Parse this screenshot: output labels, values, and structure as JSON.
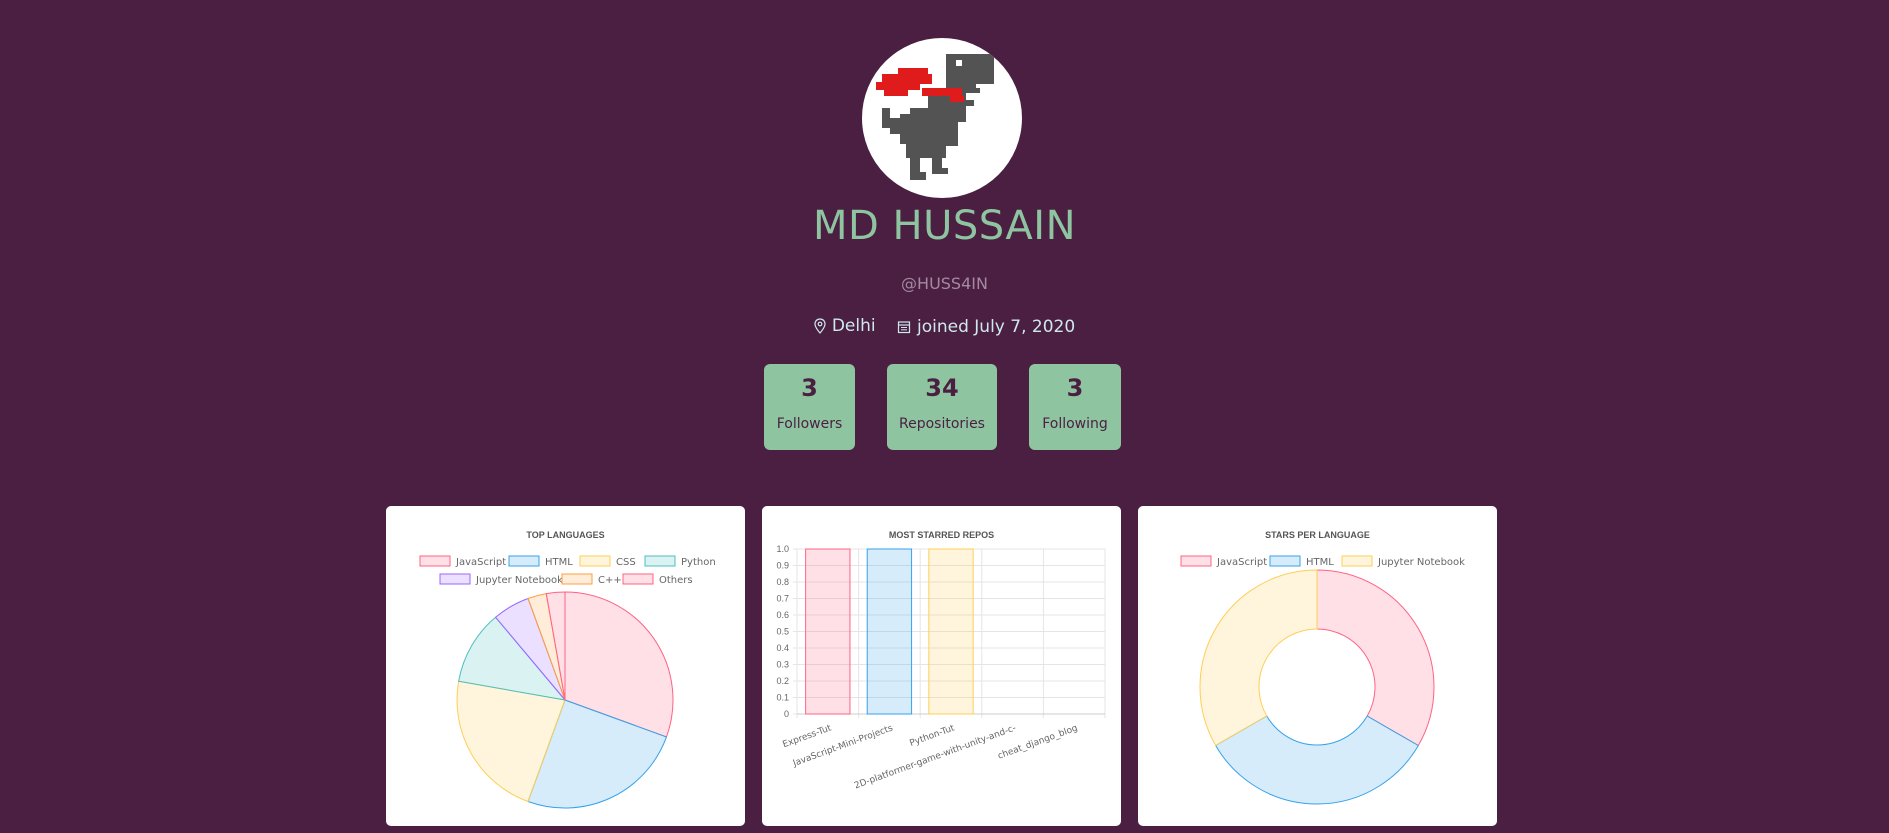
{
  "profile": {
    "name": "MD HUSSAIN",
    "handle": "@HUSS4IN",
    "location": "Delhi",
    "joined": "joined July 7, 2020"
  },
  "stats": [
    {
      "value": "3",
      "label": "Followers"
    },
    {
      "value": "34",
      "label": "Repositories"
    },
    {
      "value": "3",
      "label": "Following"
    }
  ],
  "colors": {
    "background": "#4a1f42",
    "accent": "#8ec5a0",
    "series": [
      "#ff6384",
      "#36a2eb",
      "#ffce56",
      "#4bc0c0",
      "#9966ff",
      "#ff9f40",
      "#ff6384"
    ]
  },
  "icons": {
    "location": "map-pin-icon",
    "calendar": "calendar-icon"
  },
  "chart_data": [
    {
      "type": "pie",
      "title": "TOP LANGUAGES",
      "labels": [
        "JavaScript",
        "HTML",
        "CSS",
        "Python",
        "Jupyter Notebook",
        "C++",
        "Others"
      ],
      "values": [
        11,
        9,
        8,
        4,
        2,
        1,
        1
      ],
      "legend": "top"
    },
    {
      "type": "bar",
      "title": "MOST STARRED REPOS",
      "categories": [
        "Express-Tut",
        "JavaScript-Mini-Projects",
        "Python-Tut",
        "2D-platformer-game-with-unity-and-c-",
        "cheat_django_blog"
      ],
      "values": [
        1,
        1,
        1,
        0,
        0
      ],
      "ylim": [
        0,
        1
      ],
      "yticks": [
        "0",
        "0.1",
        "0.2",
        "0.3",
        "0.4",
        "0.5",
        "0.6",
        "0.7",
        "0.8",
        "0.9",
        "1.0"
      ],
      "grid": true
    },
    {
      "type": "doughnut",
      "title": "STARS PER LANGUAGE",
      "labels": [
        "JavaScript",
        "HTML",
        "Jupyter Notebook"
      ],
      "values": [
        1,
        1,
        1
      ],
      "legend": "top"
    }
  ]
}
